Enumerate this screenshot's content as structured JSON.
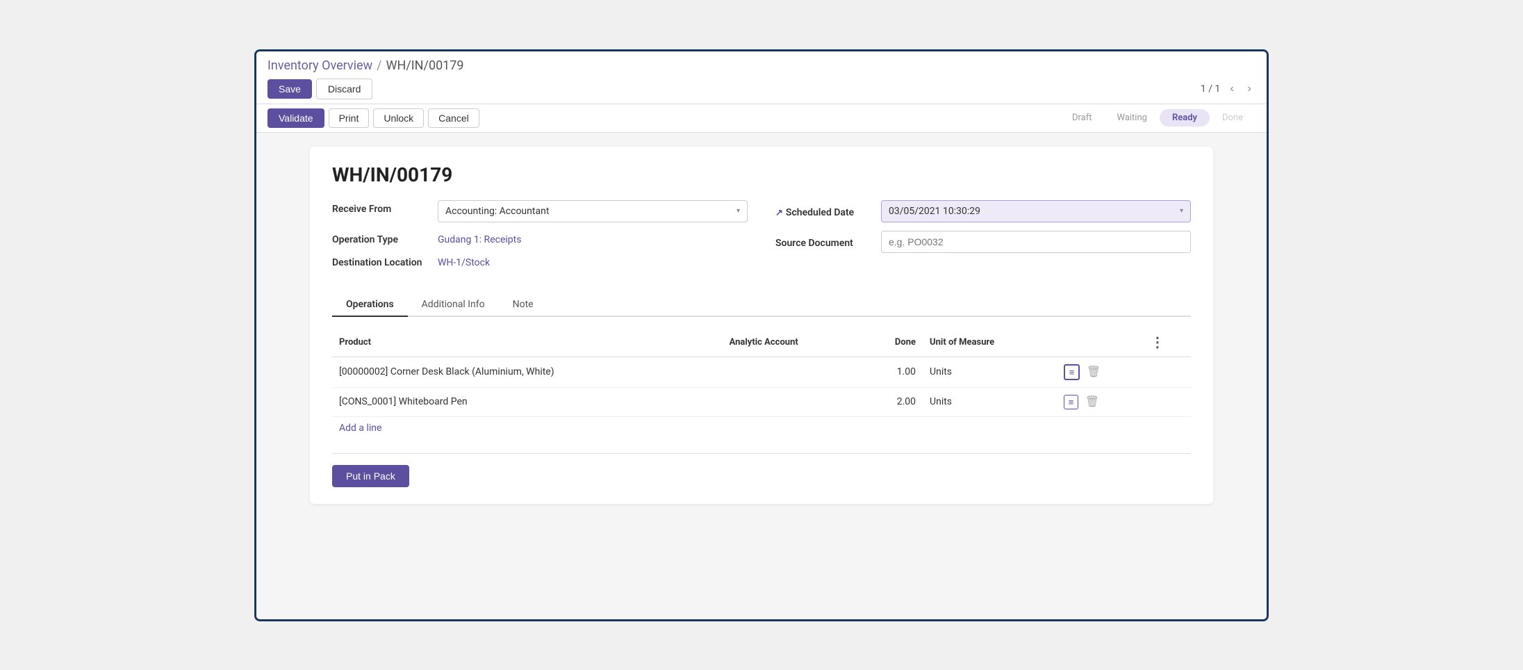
{
  "breadcrumb": {
    "parent": "Inventory Overview",
    "separator": "/",
    "current": "WH/IN/00179"
  },
  "toolbar": {
    "save_label": "Save",
    "discard_label": "Discard",
    "pagination": "1 / 1"
  },
  "action_bar": {
    "validate_label": "Validate",
    "print_label": "Print",
    "unlock_label": "Unlock",
    "cancel_label": "Cancel"
  },
  "status_bar": {
    "steps": [
      "Draft",
      "Waiting",
      "Ready",
      "Done"
    ],
    "active": "Ready"
  },
  "form": {
    "title": "WH/IN/00179",
    "receive_from_label": "Receive From",
    "receive_from_value": "Accounting: Accountant",
    "operation_type_label": "Operation Type",
    "operation_type_value": "Gudang 1: Receipts",
    "destination_label": "Destination Location",
    "destination_value": "WH-1/Stock",
    "scheduled_date_label": "Scheduled Date",
    "scheduled_date_value": "03/05/2021 10:30:29",
    "source_doc_label": "Source Document",
    "source_doc_placeholder": "e.g. PO0032"
  },
  "tabs": [
    {
      "label": "Operations",
      "active": true
    },
    {
      "label": "Additional Info",
      "active": false
    },
    {
      "label": "Note",
      "active": false
    }
  ],
  "table": {
    "columns": [
      "Product",
      "Analytic Account",
      "Done",
      "Unit of Measure",
      "",
      ""
    ],
    "rows": [
      {
        "product": "[00000002] Corner Desk Black (Aluminium, White)",
        "analytic_account": "",
        "done": "1.00",
        "unit": "Units",
        "detail_active": true
      },
      {
        "product": "[CONS_0001] Whiteboard Pen",
        "analytic_account": "",
        "done": "2.00",
        "unit": "Units",
        "detail_active": false
      }
    ],
    "add_line_label": "Add a line"
  },
  "footer": {
    "put_in_pack_label": "Put in Pack"
  },
  "icons": {
    "dropdown": "▾",
    "external_link": "↗",
    "prev": "‹",
    "next": "›",
    "detail": "≡",
    "delete": "🗑",
    "more": "⋮"
  }
}
